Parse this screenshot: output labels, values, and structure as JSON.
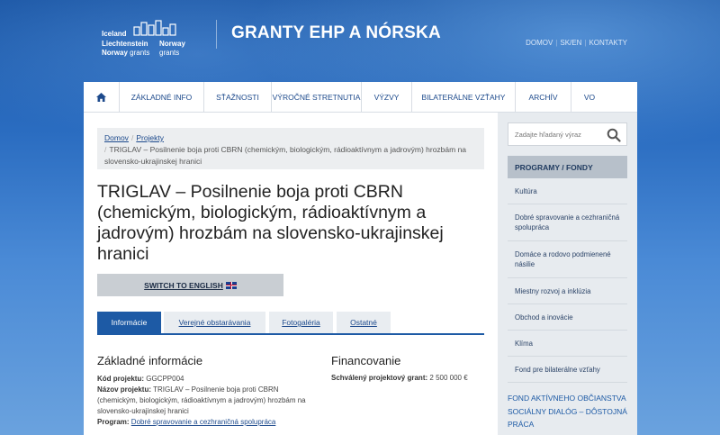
{
  "header": {
    "logo": {
      "line1": "Iceland",
      "line2": "Liechtenstein",
      "line3a": "Norway",
      "line3b": "grants",
      "right1": "Norway",
      "right2": "grants"
    },
    "site_title": "GRANTY EHP A NÓRSKA",
    "toplinks": [
      "DOMOV",
      "SK/EN",
      "KONTAKTY"
    ]
  },
  "nav": {
    "items": [
      "ZÁKLADNÉ INFO",
      "SŤAŽNOSTI",
      "VÝROČNÉ STRETNUTIA",
      "VÝZVY",
      "BILATERÁLNE VZŤAHY",
      "ARCHÍV",
      "VO"
    ]
  },
  "breadcrumb": {
    "home": "Domov",
    "projects": "Projekty",
    "current": "TRIGLAV – Posilnenie boja proti CBRN (chemickým, biologickým, rádioaktívnym a jadrovým) hrozbám na slovensko-ukrajinskej hranici"
  },
  "page": {
    "title": "TRIGLAV – Posilnenie boja proti CBRN (chemickým, biologickým, rádioaktívnym a jadrovým) hrozbám na slovensko-ukrajinskej hranici",
    "switch_label": "SWITCH TO ENGLISH"
  },
  "tabs": [
    "Informácie",
    "Verejné obstarávania",
    "Fotogaléria",
    "Ostatné"
  ],
  "basic_info": {
    "heading": "Základné informácie",
    "code_label": "Kód projektu:",
    "code_value": "GGCPP004",
    "name_label": "Názov projektu:",
    "name_value": "TRIGLAV – Posilnenie boja proti CBRN (chemickým, biologickým, rádioaktívnym a jadrovým) hrozbám na slovensko-ukrajinskej hranici",
    "program_label": "Program:",
    "program_value": "Dobré spravovanie a cezhraničná spolupráca"
  },
  "financing": {
    "heading": "Financovanie",
    "grant_label": "Schválený projektový grant:",
    "grant_value": "2 500 000 €"
  },
  "sidebar": {
    "search_placeholder": "Zadajte hľadaný výraz",
    "programs_heading": "PROGRAMY / FONDY",
    "items": [
      "Kultúra",
      "Dobré spravovanie a cezhraničná spolupráca",
      "Domáce a rodovo podmienené násilie",
      "Miestny rozvoj a inklúzia",
      "Obchod a inovácie",
      "Klíma",
      "Fond pre bilaterálne vzťahy"
    ],
    "fund1": "FOND AKTÍVNEHO OBČIANSTVA",
    "fund2": "SOCIÁLNY DIALÓG – DÔSTOJNÁ PRÁCA"
  }
}
